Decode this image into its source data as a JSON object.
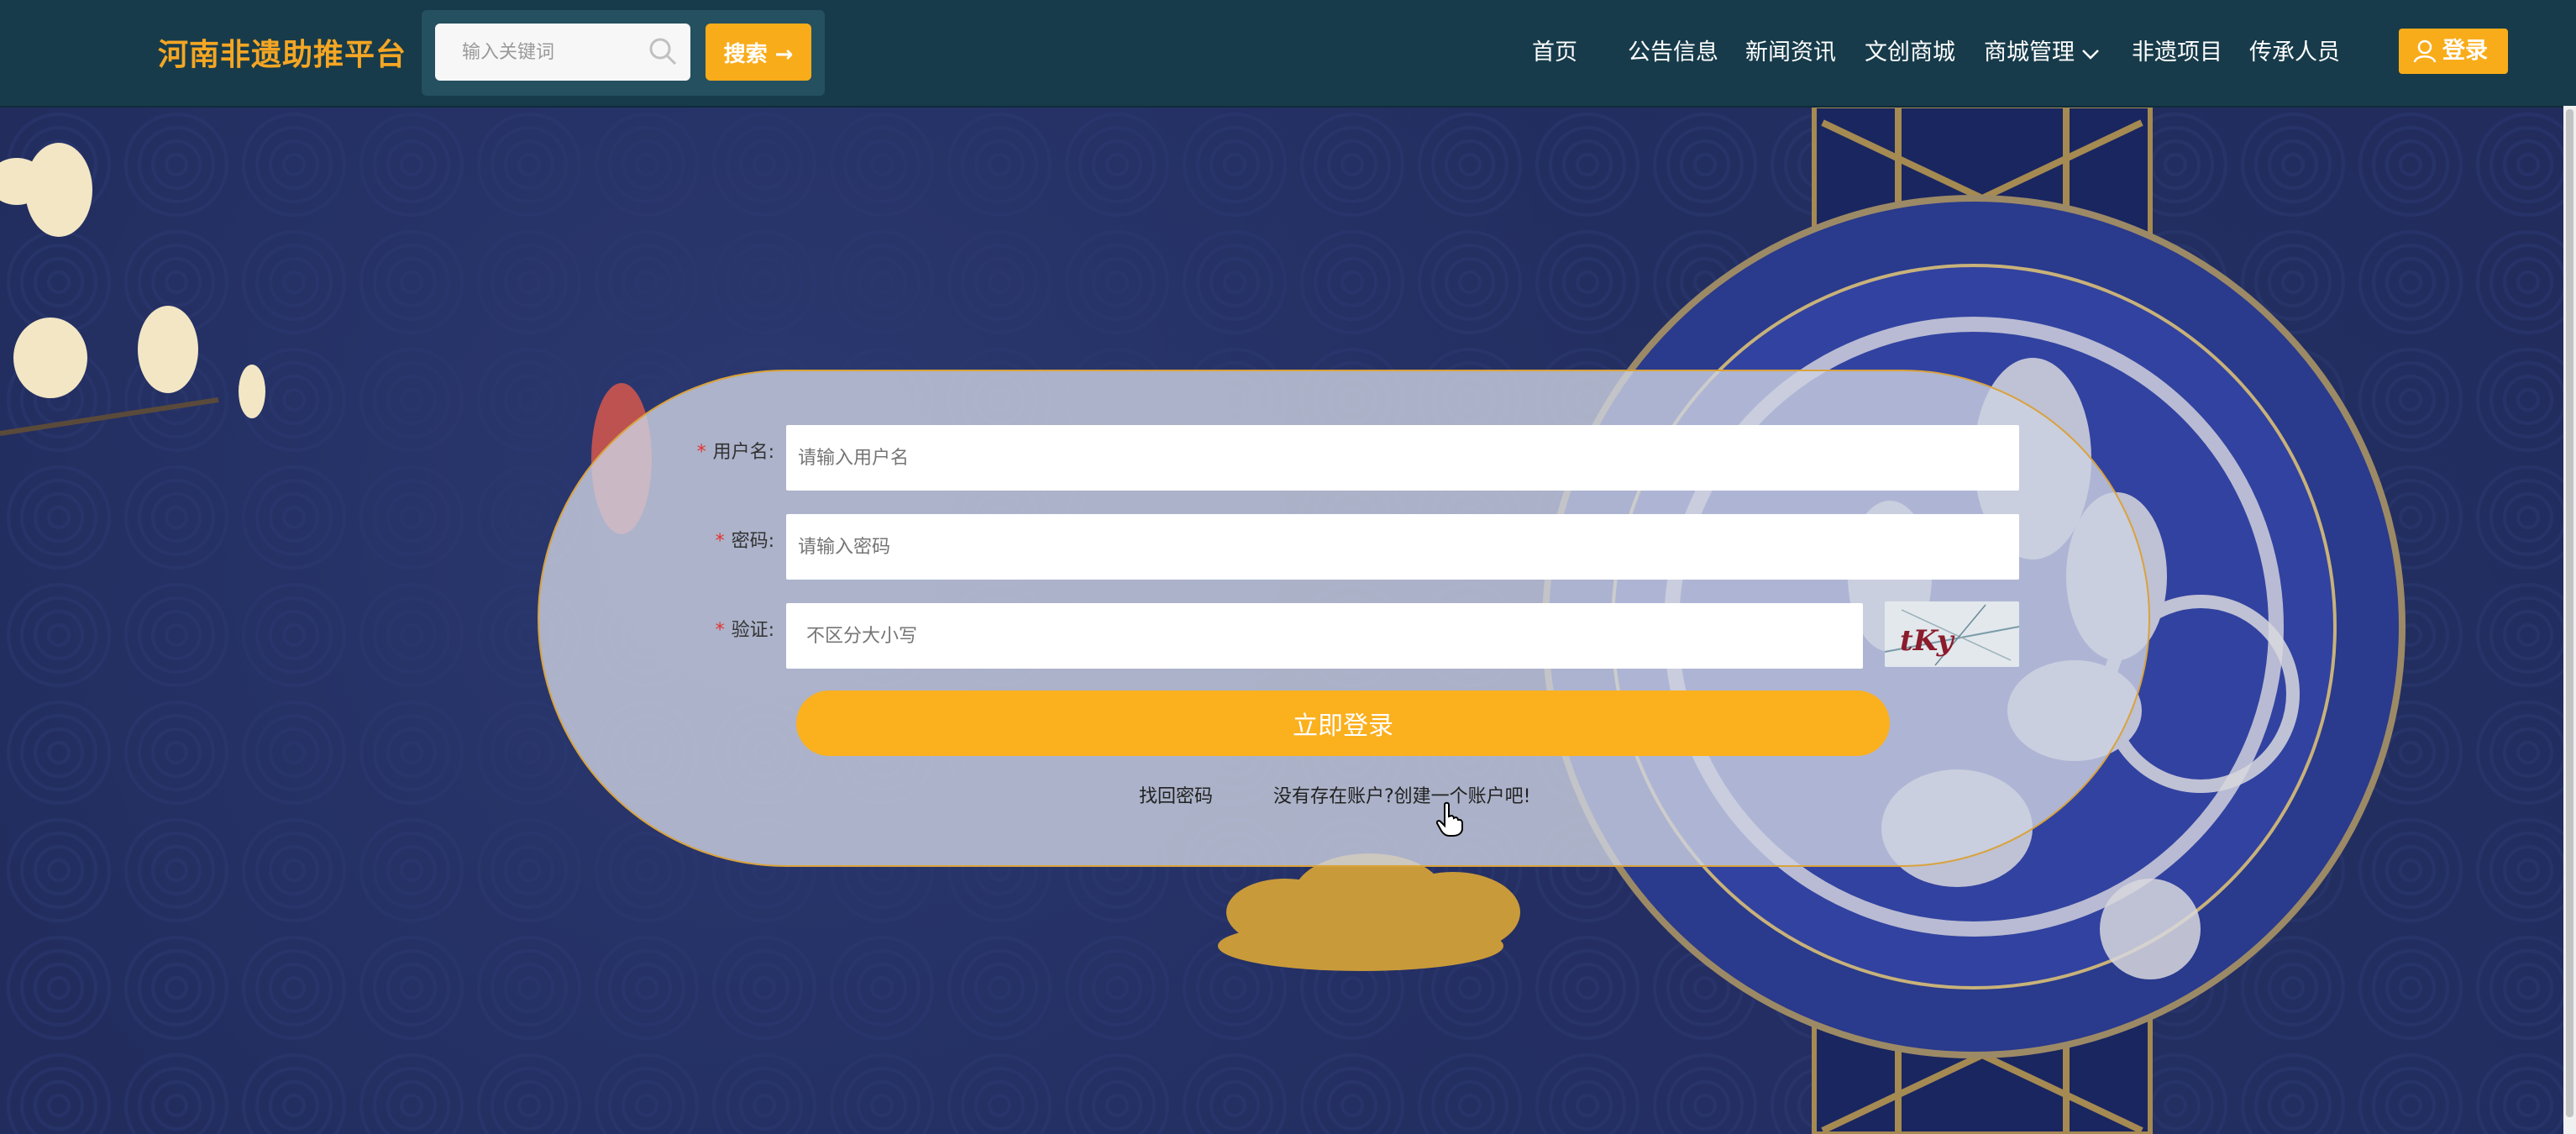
{
  "header": {
    "brand": "河南非遗助推平台",
    "search": {
      "placeholder": "输入关键词",
      "button_label": "搜索 →"
    },
    "nav": [
      {
        "label": "首页"
      },
      {
        "label": "公告信息"
      },
      {
        "label": "新闻资讯"
      },
      {
        "label": "文创商城"
      },
      {
        "label": "商城管理"
      },
      {
        "label": "非遗项目"
      },
      {
        "label": "传承人员"
      }
    ],
    "login_label": "登录"
  },
  "login_form": {
    "username": {
      "label": "用户名:",
      "placeholder": "请输入用户名"
    },
    "password": {
      "label": "密码:",
      "placeholder": "请输入密码"
    },
    "captcha": {
      "label": "验证:",
      "placeholder": "不区分大小写",
      "image_text": "tKy"
    },
    "submit_label": "立即登录",
    "forgot_link": "找回密码",
    "register_link": "没有存在账户?创建一个账户吧!"
  },
  "colors": {
    "accent": "#f9ac1a",
    "header_bg": "#173b4a",
    "brand": "#f5a623"
  }
}
